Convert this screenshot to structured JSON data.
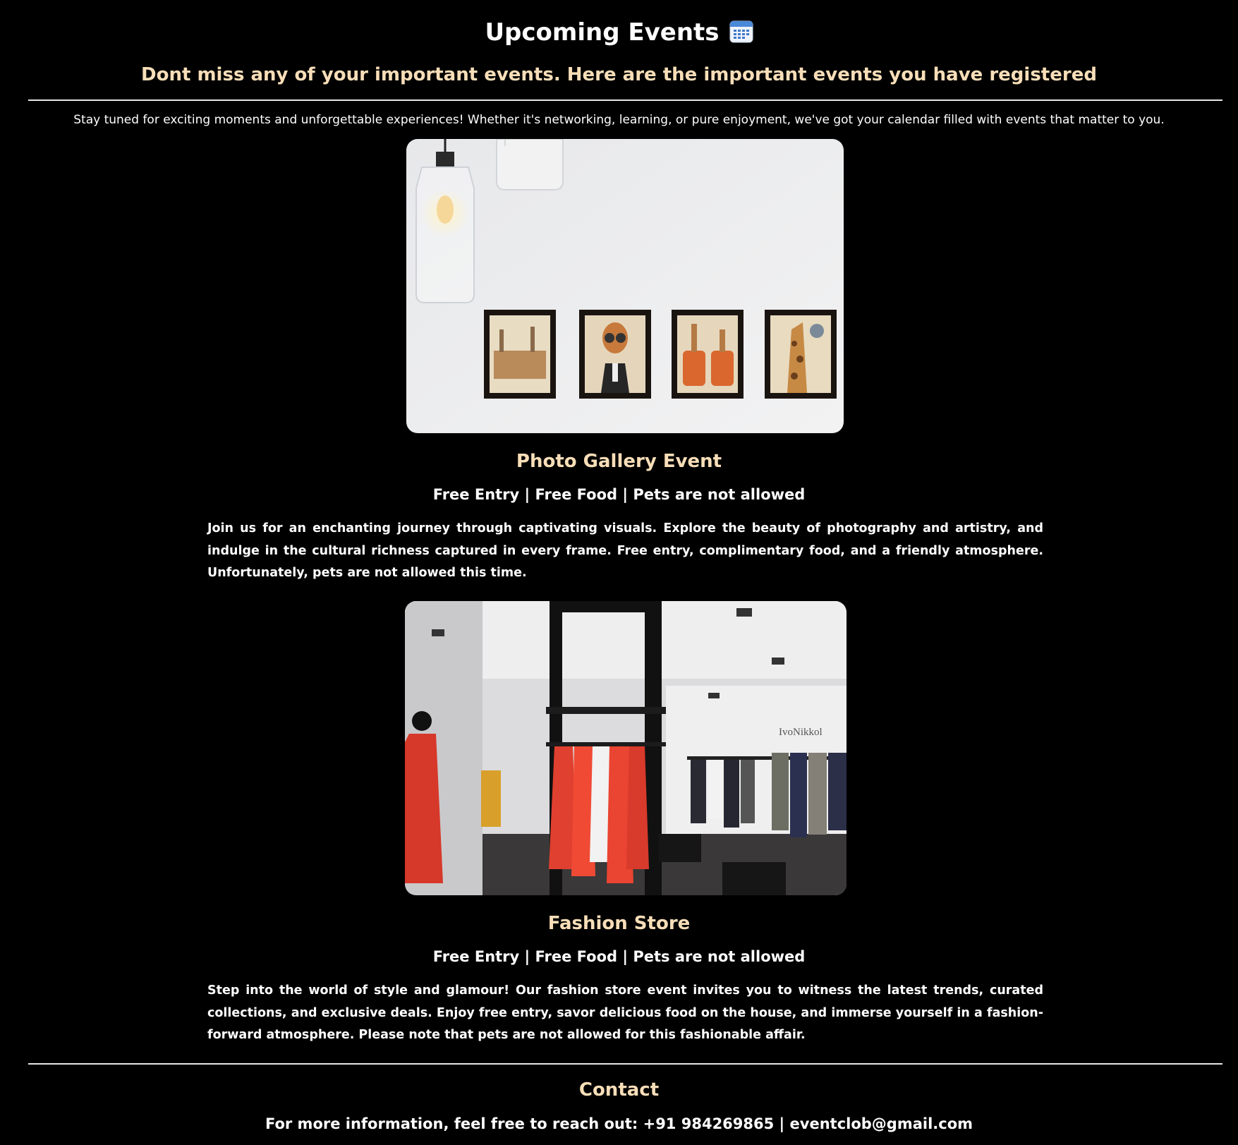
{
  "header": {
    "title": "Upcoming Events",
    "title_icon": "calendar-icon",
    "subtitle": "Dont miss any of your important events. Here are the important events you have registered"
  },
  "intro": "Stay tuned for exciting moments and unforgettable experiences! Whether it's networking, learning, or pure enjoyment, we've got your calendar filled with events that matter to you.",
  "events": [
    {
      "name": "Photo Gallery Event",
      "tags": "Free Entry | Free Food | Pets are not allowed",
      "description": "Join us for an enchanting journey through captivating visuals. Explore the beauty of photography and artistry, and indulge in the cultural richness captured in every frame. Free entry, complimentary food, and a friendly atmosphere. Unfortunately, pets are not allowed this time.",
      "image": "photo of four framed giraffe prints on a white wall with hanging glass lamps"
    },
    {
      "name": "Fashion Store",
      "tags": "Free Entry | Free Food | Pets are not allowed",
      "description": "Step into the world of style and glamour! Our fashion store event invites you to witness the latest trends, curated collections, and exclusive deals. Enjoy free entry, savor delicious food on the house, and immerse yourself in a fashion-forward atmosphere. Please note that pets are not allowed for this fashionable affair.",
      "image": "photo of a clothing store interior with red dresses on racks and a mannequin",
      "image_sign": "IvoNikkol"
    }
  ],
  "contact": {
    "title": "Contact",
    "line": "For more information, feel free to reach out: +91 984269865 | eventclob@gmail.com"
  },
  "colors": {
    "background": "#000000",
    "accent": "#f8deb8",
    "text": "#ffffff"
  }
}
